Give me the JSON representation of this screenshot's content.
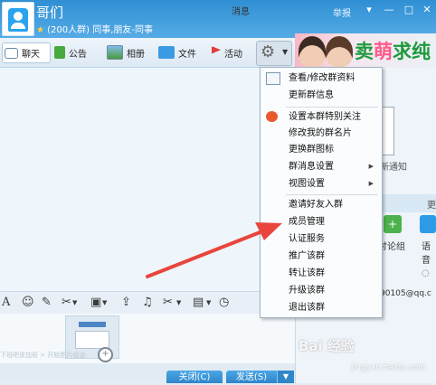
{
  "title_bar": {
    "group_name": "哥们",
    "group_info": "(200人群) 同事,朋友-同事",
    "report": "举报",
    "window_buttons": [
      "▾",
      "—",
      "□",
      "✕"
    ]
  },
  "toolbar": {
    "tabs": [
      {
        "label": "聊天",
        "icon": "chat-bubble-icon"
      },
      {
        "label": "公告",
        "icon": "flag-icon"
      },
      {
        "label": "相册",
        "icon": "photo-icon"
      },
      {
        "label": "文件",
        "icon": "folder-icon"
      },
      {
        "label": "活动",
        "icon": "pin-flag-icon"
      }
    ],
    "settings_icon": "gear-icon"
  },
  "ad": {
    "text_green": "卖",
    "text_pink": "萌",
    "text_rest": "求纯"
  },
  "input_toolbar": {
    "message_record": "消息"
  },
  "faint_text": "下班吧该加班 > 开始图片组设:",
  "bottom": {
    "close_label": "关闭(C)",
    "send_label": "发送(S)"
  },
  "right_panel": {
    "new_notice": "新通知",
    "more": "更",
    "discuss_label": "讨论组",
    "voice_label": "语音",
    "email_peek": "90105@qq.c"
  },
  "menu": {
    "items": [
      {
        "label": "查看/修改群资料",
        "icon": "profile-card-icon"
      },
      {
        "label": "更新群信息"
      },
      {
        "label": "设置本群特别关注",
        "icon": "qq-attention-icon"
      },
      {
        "label": "修改我的群名片"
      },
      {
        "label": "更换群图标"
      },
      {
        "label": "群消息设置",
        "submenu": true
      },
      {
        "label": "视图设置",
        "submenu": true
      },
      {
        "label": "邀请好友入群"
      },
      {
        "label": "成员管理"
      },
      {
        "label": "认证服务"
      },
      {
        "label": "推广该群"
      },
      {
        "label": "转让该群"
      },
      {
        "label": "升级该群"
      },
      {
        "label": "退出该群"
      }
    ]
  },
  "watermark": {
    "brand": "Bai 经验",
    "url": "jingyan.baidu.com"
  },
  "colors": {
    "accent": "#2f8fd3",
    "arrow": "#e8453c",
    "menu_bg": "#fafcfe"
  }
}
